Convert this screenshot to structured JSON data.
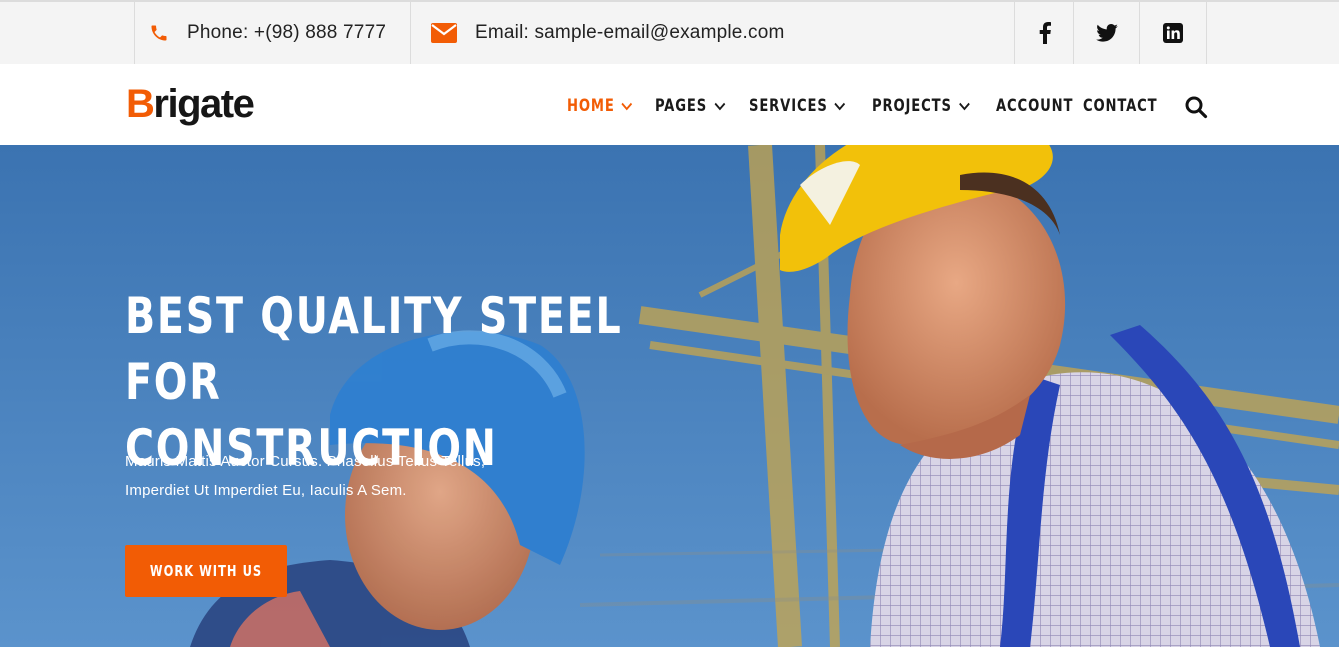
{
  "topbar": {
    "phone": "Phone: +(98) 888 7777",
    "email": "Email: sample-email@example.com",
    "icons": {
      "phone": "phone-icon",
      "email": "email-icon"
    },
    "social": [
      "facebook-icon",
      "twitter-icon",
      "linkedin-icon"
    ]
  },
  "header": {
    "logo_first": "B",
    "logo_rest": "rigate",
    "nav": [
      {
        "label": "HOME",
        "has_dropdown": true,
        "active": true
      },
      {
        "label": "PAGES",
        "has_dropdown": true
      },
      {
        "label": "SERVICES",
        "has_dropdown": true
      },
      {
        "label": "PROJECTS",
        "has_dropdown": true
      },
      {
        "label": "ACCOUNT",
        "has_dropdown": false
      },
      {
        "label": "CONTACT",
        "has_dropdown": false
      }
    ],
    "search_icon": "search-icon"
  },
  "hero": {
    "title_line1": "BEST QUALITY STEEL FOR",
    "title_line2": "CONSTRUCTION",
    "subtitle_line1": "Mauris Mattis Auctor Cursus. Phasellus Tellus Tellus,",
    "subtitle_line2": "Imperdiet Ut Imperdiet Eu, Iaculis A Sem.",
    "cta_label": "WORK WITH US"
  },
  "colors": {
    "accent": "#f25c05",
    "topbar_bg": "#f4f4f4",
    "sky": "#4d86c2",
    "text_dark": "#1a1a1a"
  }
}
